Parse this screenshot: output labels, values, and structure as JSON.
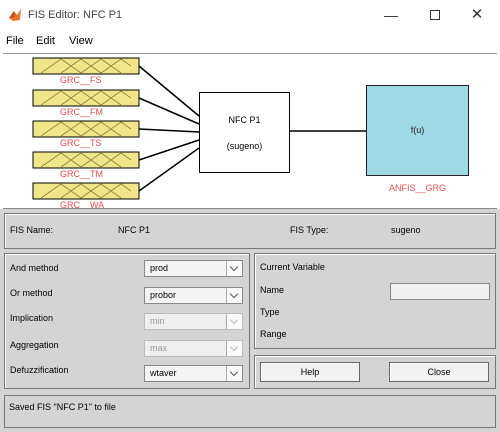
{
  "window": {
    "title": "FIS Editor: NFC P1",
    "minimize": "—",
    "close": "✕"
  },
  "menu": [
    "File",
    "Edit",
    "View"
  ],
  "diagram": {
    "inputs": [
      "GRC__FS",
      "GRC__FM",
      "GRC__TS",
      "GRC__TM",
      "GRC__WA"
    ],
    "system_name": "NFC P1",
    "system_type": "(sugeno)",
    "output_function": "f(u)",
    "output_name": "ANFIS__GRG",
    "input_color": "#f1e58a",
    "output_color": "#9fd9e5",
    "label_color": "#e05050"
  },
  "info": {
    "fis_name_label": "FIS Name:",
    "fis_name": "NFC P1",
    "fis_type_label": "FIS Type:",
    "fis_type": "sugeno"
  },
  "methods": {
    "and_label": "And method",
    "and_value": "prod",
    "or_label": "Or method",
    "or_value": "probor",
    "implication_label": "Implication",
    "implication_value": "min",
    "aggregation_label": "Aggregation",
    "aggregation_value": "max",
    "defuzz_label": "Defuzzification",
    "defuzz_value": "wtaver"
  },
  "current_variable": {
    "title": "Current Variable",
    "name_label": "Name",
    "name_value": "",
    "type_label": "Type",
    "range_label": "Range"
  },
  "buttons": {
    "help": "Help",
    "close": "Close"
  },
  "status": "Saved FIS \"NFC P1\" to file"
}
